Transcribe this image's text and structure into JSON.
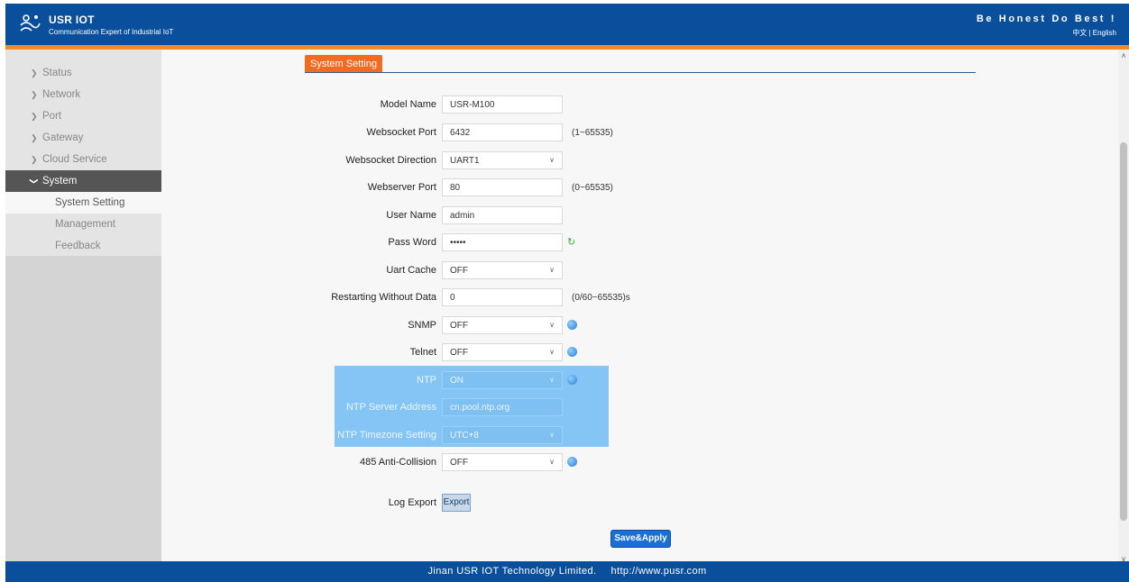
{
  "header": {
    "brand": "USR IOT",
    "tagline": "Communication Expert of Industrial IoT",
    "motto": "Be Honest Do Best !",
    "lang_cn": "中文",
    "lang_sep": " | ",
    "lang_en": "English"
  },
  "sidebar": {
    "items": [
      {
        "label": "Status"
      },
      {
        "label": "Network"
      },
      {
        "label": "Port"
      },
      {
        "label": "Gateway"
      },
      {
        "label": "Cloud Service"
      },
      {
        "label": "System"
      }
    ],
    "subitems": [
      {
        "label": "System Setting"
      },
      {
        "label": "Management"
      },
      {
        "label": "Feedback"
      }
    ]
  },
  "main": {
    "tab": "System Setting",
    "fields": {
      "model_name": {
        "label": "Model Name",
        "value": "USR-M100"
      },
      "websocket_port": {
        "label": "Websocket Port",
        "value": "6432",
        "hint": "(1~65535)"
      },
      "websocket_direction": {
        "label": "Websocket Direction",
        "value": "UART1"
      },
      "webserver_port": {
        "label": "Webserver Port",
        "value": "80",
        "hint": "(0~65535)"
      },
      "user_name": {
        "label": "User Name",
        "value": "admin"
      },
      "password": {
        "label": "Pass Word",
        "value": "•••••"
      },
      "uart_cache": {
        "label": "Uart Cache",
        "value": "OFF"
      },
      "restarting": {
        "label": "Restarting Without Data",
        "value": "0",
        "hint": "(0/60~65535)s"
      },
      "snmp": {
        "label": "SNMP",
        "value": "OFF"
      },
      "telnet": {
        "label": "Telnet",
        "value": "OFF"
      },
      "ntp": {
        "label": "NTP",
        "value": "ON"
      },
      "ntp_server": {
        "label": "NTP Server Address",
        "value": "cn.pool.ntp.org"
      },
      "ntp_timezone": {
        "label": "NTP Timezone Setting",
        "value": "UTC+8"
      },
      "anti_collision": {
        "label": "485 Anti-Collision",
        "value": "OFF"
      },
      "log_export": {
        "label": "Log Export",
        "button": "Export"
      }
    },
    "save_button": "Save&Apply"
  },
  "footer": {
    "company": "Jinan USR IOT Technology Limited.",
    "url": "http://www.pusr.com"
  },
  "colors": {
    "header_bg": "#0a4f9c",
    "accent": "#f08c28",
    "tab": "#f36b21",
    "highlight": "#85c5f5",
    "button": "#1a6fd6"
  }
}
